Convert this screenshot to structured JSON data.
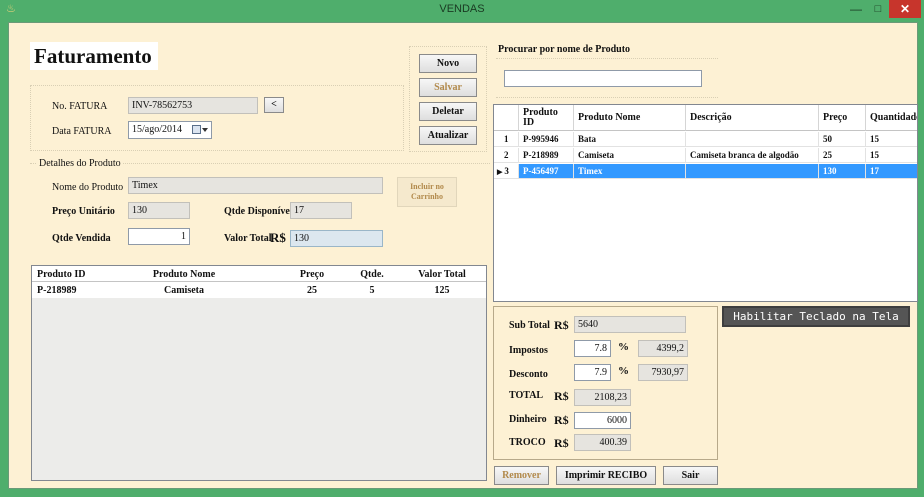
{
  "window": {
    "title": "VENDAS",
    "minimize": "—",
    "maximize": "□",
    "close": "✕",
    "app_icon": "♨"
  },
  "page": {
    "heading": "Faturamento"
  },
  "actions": {
    "novo": "Novo",
    "salvar": "Salvar",
    "deletar": "Deletar",
    "atualizar": "Atualizar"
  },
  "invoice": {
    "number_label": "No. FATURA",
    "number_value": "INV-78562753",
    "lookup_button": "<",
    "date_label": "Data FATURA",
    "date_value": "15/ago/2014"
  },
  "details": {
    "group_title": "Detalhes do Produto",
    "product_name_label": "Nome do Produto",
    "product_name_value": "Timex",
    "add_to_cart": "Incluir no Carrinho",
    "unit_price_label": "Preço Unitário",
    "unit_price_value": "130",
    "stock_label": "Qtde Disponível",
    "stock_value": "17",
    "qty_sold_label": "Qtde Vendida",
    "qty_sold_value": "1",
    "total_label": "Valor Total",
    "currency": "R$",
    "total_value": "130"
  },
  "cart": {
    "headers": [
      "Produto ID",
      "Produto Nome",
      "Preço",
      "Qtde.",
      "Valor Total"
    ],
    "rows": [
      [
        "P-218989",
        "Camiseta",
        "25",
        "5",
        "125"
      ]
    ]
  },
  "search": {
    "title": "Procurar por nome de Produto",
    "value": ""
  },
  "products": {
    "headers": [
      "Produto ID",
      "Produto Nome",
      "Descrição",
      "Preço",
      "Quantidade"
    ],
    "rows": [
      {
        "num": "1",
        "id": "P-995946",
        "name": "Bata",
        "desc": "",
        "price": "50",
        "qty": "15"
      },
      {
        "num": "2",
        "id": "P-218989",
        "name": "Camiseta",
        "desc": "Camiseta branca de algodão",
        "price": "25",
        "qty": "15"
      },
      {
        "num": "3",
        "id": "P-456497",
        "name": "Timex",
        "desc": "",
        "price": "130",
        "qty": "17"
      }
    ],
    "selected_index": 2
  },
  "totals": {
    "subtotal_label": "Sub Total",
    "subtotal_value": "5640",
    "currency": "R$",
    "tax_label": "Impostos",
    "tax_rate": "7.8",
    "tax_value": "4399,2",
    "discount_label": "Desconto",
    "discount_rate": "7.9",
    "discount_value": "7930,97",
    "percent": "%",
    "total_label": "TOTAL",
    "total_value": "2108,23",
    "cash_label": "Dinheiro",
    "cash_value": "6000",
    "change_label": "TROCO",
    "change_value": "400.39"
  },
  "footer": {
    "remove": "Remover",
    "print": "Imprimir RECIBO",
    "exit": "Sair"
  },
  "keyboard_toggle": "Habilitar Teclado na Tela"
}
